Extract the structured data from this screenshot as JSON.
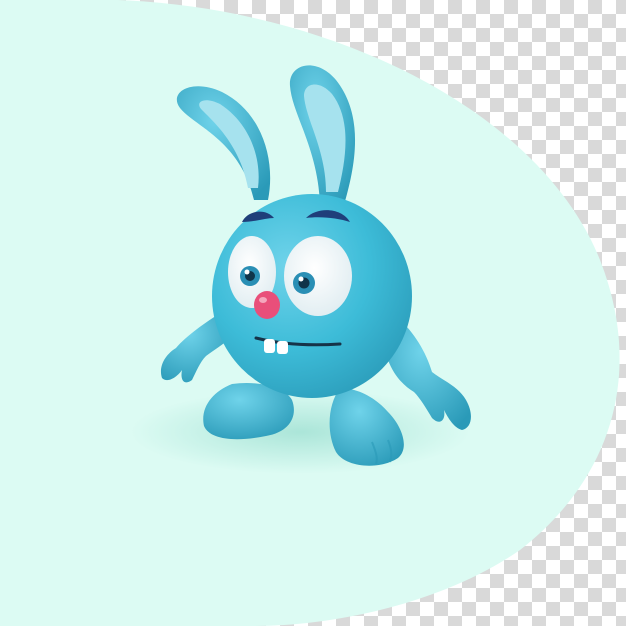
{
  "scene": {
    "subject": "blue-bunny-character",
    "colors": {
      "checker_light": "#ffffff",
      "checker_dark": "#d9d9d9",
      "backdrop": "#dcfbf3",
      "body": "#3dbcd8",
      "body_shade": "#2a9ab8",
      "body_light": "#6fd3ea",
      "inner_ear": "#a6e2ee",
      "eye_white": "#ffffff",
      "iris": "#2a8fb5",
      "pupil": "#10344a",
      "brow": "#1f3f7a",
      "nose": "#e94f7a",
      "mouth": "#163348",
      "teeth": "#ffffff",
      "shadow": "#9fe0d2"
    }
  }
}
